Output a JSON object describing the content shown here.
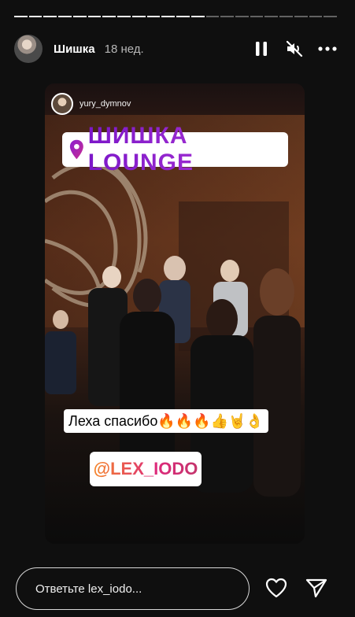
{
  "story": {
    "segments_total": 22,
    "segments_done": 13,
    "username": "Шишка",
    "time_ago": "18 нед.",
    "credit_username": "yury_dymnov",
    "location_sticker": "ШИШКА LOUNGE",
    "caption": "Леха спасибо🔥🔥🔥👍🤘👌",
    "mention": "@LEX_IODO"
  },
  "controls": {
    "pause_icon": "pause-icon",
    "mute_icon": "speaker-muted-icon",
    "more_icon": "more-horizontal-icon"
  },
  "reply": {
    "placeholder": "Ответьте lex_iodo...",
    "like_icon": "heart-icon",
    "share_icon": "send-icon"
  }
}
